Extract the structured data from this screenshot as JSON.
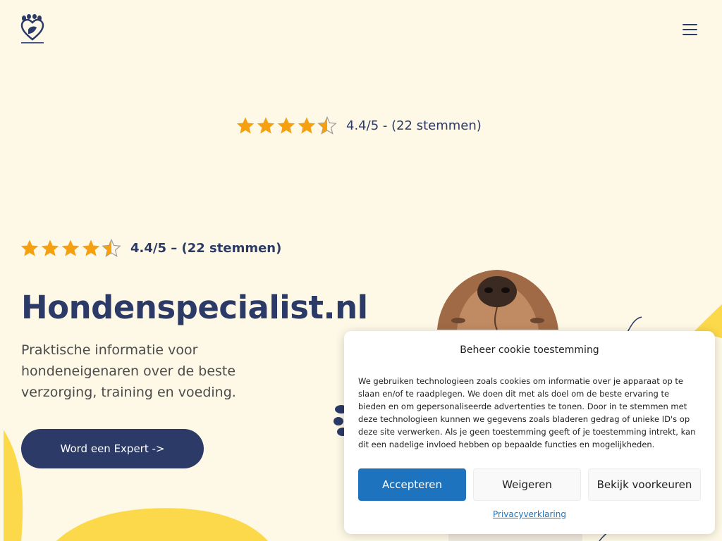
{
  "header": {
    "logo_icon": "dog-paw-heart-logo",
    "menu_icon": "hamburger-menu-icon"
  },
  "rating_top": {
    "value": 4.4,
    "max": 5,
    "text": "4.4/5 - (22 stemmen)"
  },
  "hero": {
    "rating": {
      "value": 4.4,
      "max": 5,
      "text": "4.4/5 – (22 stemmen)"
    },
    "title": "Hondenspecialist.nl",
    "subtitle": "Praktische informatie voor hondeneigenaren over de beste verzorging, training en voeding.",
    "cta_label": "Word een Expert ->"
  },
  "colors": {
    "background": "#fef8e6",
    "navy": "#2b3a67",
    "yellow": "#fcd94a",
    "star": "#f5a011",
    "accept_blue": "#1e73be"
  },
  "cookie": {
    "title": "Beheer cookie toestemming",
    "body": "We gebruiken technologieen zoals cookies om informatie over je apparaat op te slaan en/of te raadplegen. We doen dit met als doel om de beste ervaring te bieden en om gepersonaliseerde advertenties te tonen. Door in te stemmen met deze technologieen kunnen we gegevens zoals bladeren gedrag of unieke ID's op deze site verwerken. Als je geen toestemming geeft of je toestemming intrekt, kan dit een nadelige invloed hebben op bepaalde functies en mogelijkheden.",
    "accept_label": "Accepteren",
    "deny_label": "Weigeren",
    "prefs_label": "Bekijk voorkeuren",
    "privacy_label": "Privacyverklaring"
  }
}
